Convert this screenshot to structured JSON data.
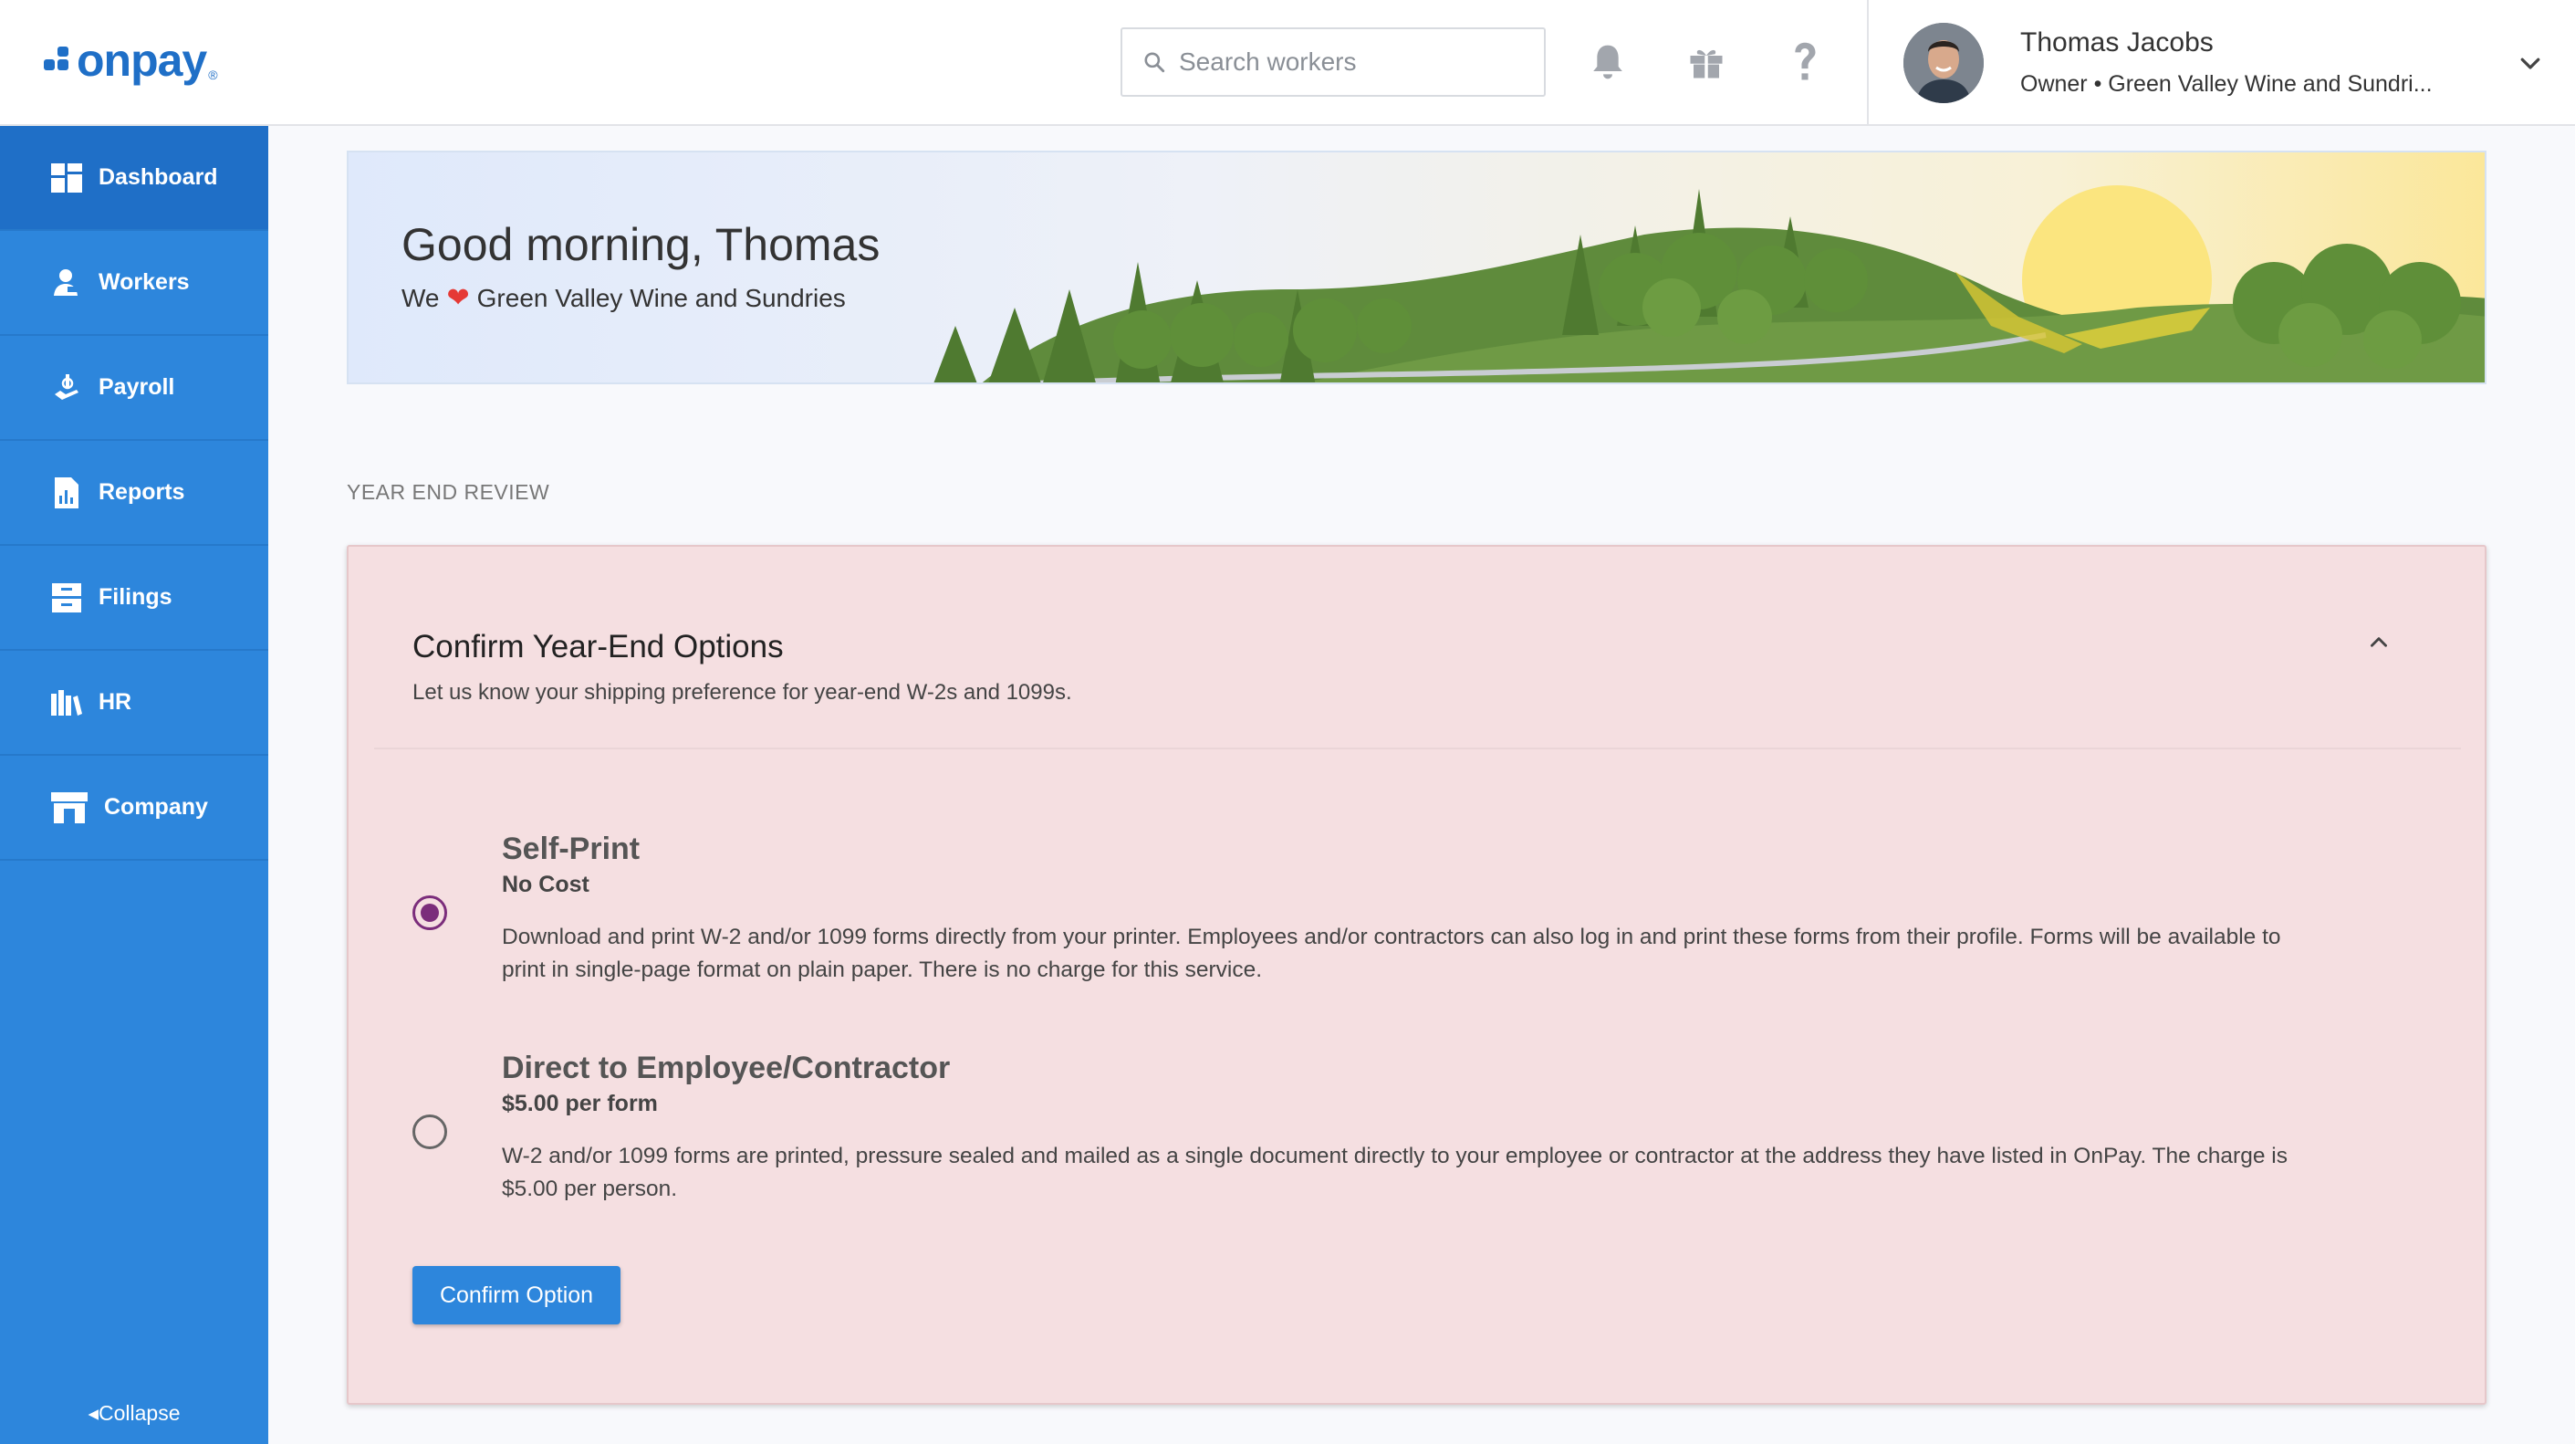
{
  "app": {
    "logo_text": "onpay",
    "logo_mark": "®",
    "brand_color": "#1f6fc7"
  },
  "header": {
    "search": {
      "placeholder": "Search workers",
      "value": ""
    },
    "icons": [
      "bell-icon",
      "gift-icon",
      "help-icon"
    ],
    "user": {
      "name": "Thomas Jacobs",
      "role": "Owner • Green Valley Wine and Sundri..."
    }
  },
  "sidebar": {
    "items": [
      {
        "label": "Dashboard",
        "icon": "dashboard-icon",
        "active": true
      },
      {
        "label": "Workers",
        "icon": "workers-icon",
        "active": false
      },
      {
        "label": "Payroll",
        "icon": "payroll-icon",
        "active": false
      },
      {
        "label": "Reports",
        "icon": "reports-icon",
        "active": false
      },
      {
        "label": "Filings",
        "icon": "filings-icon",
        "active": false
      },
      {
        "label": "HR",
        "icon": "hr-icon",
        "active": false
      },
      {
        "label": "Company",
        "icon": "company-icon",
        "active": false
      }
    ],
    "collapse_label": "Collapse",
    "bg_color": "#2d86dc",
    "active_color": "#1f6fc7"
  },
  "banner": {
    "greeting": "Good morning, Thomas",
    "we": "We",
    "heart": "❤",
    "company": "Green Valley Wine and Sundries"
  },
  "section": {
    "label": "YEAR END REVIEW"
  },
  "card": {
    "title": "Confirm Year-End Options",
    "subtitle": "Let us know your shipping preference for year-end W-2s and 1099s.",
    "bg_color": "#f5dfe1",
    "options": [
      {
        "title": "Self-Print",
        "price": "No Cost",
        "description": "Download and print W-2 and/or 1099 forms directly from your printer. Employees and/or contractors can also log in and print these forms from their profile. Forms will be available to print in single-page format on plain paper. There is no charge for this service.",
        "selected": true
      },
      {
        "title": "Direct to Employee/Contractor",
        "price": "$5.00 per form",
        "description": "W-2 and/or 1099 forms are printed, pressure sealed and mailed as a single document directly to your employee or contractor at the address they have listed in OnPay. The charge is $5.00 per person.",
        "selected": false
      }
    ],
    "confirm_label": "Confirm Option"
  }
}
